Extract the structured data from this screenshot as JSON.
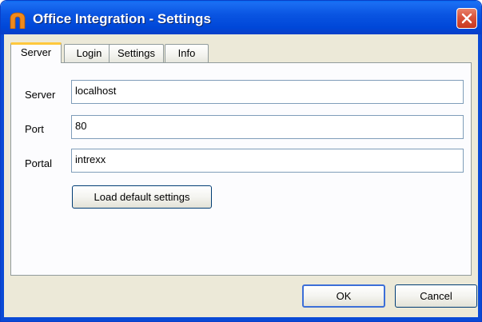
{
  "window": {
    "title": "Office Integration - Settings",
    "icon": "intrexx-app-icon",
    "close_icon": "close-icon"
  },
  "tabs": [
    {
      "label": "Server",
      "active": true
    },
    {
      "label": "Login",
      "active": false
    },
    {
      "label": "Settings",
      "active": false
    },
    {
      "label": "Info",
      "active": false
    }
  ],
  "form": {
    "server": {
      "label": "Server",
      "value": "localhost"
    },
    "port": {
      "label": "Port",
      "value": "80"
    },
    "portal": {
      "label": "Portal",
      "value": "intrexx"
    },
    "load_defaults_label": "Load default settings"
  },
  "footer": {
    "ok_label": "OK",
    "cancel_label": "Cancel"
  },
  "colors": {
    "titlebar": "#0047d8",
    "close_button": "#d9533c",
    "active_tab_accent": "#ffc83c",
    "dialog_background": "#ece9d8",
    "app_icon": "#f08a1c"
  }
}
